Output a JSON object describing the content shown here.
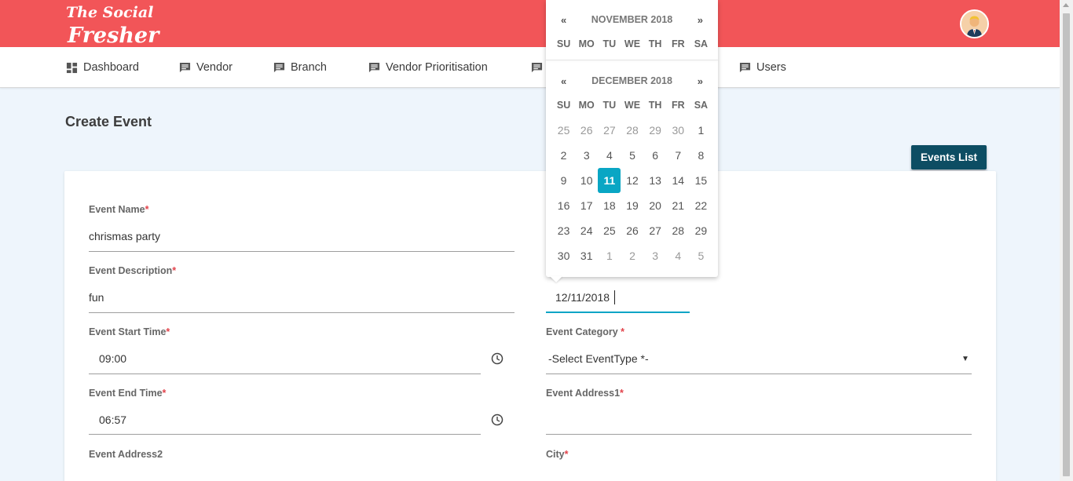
{
  "brand": {
    "logo_text": "The Social Fresher",
    "accent_color": "#f25558"
  },
  "nav": {
    "items": [
      {
        "label": "Dashboard",
        "icon": "dashboard-icon"
      },
      {
        "label": "Vendor",
        "icon": "chat-icon"
      },
      {
        "label": "Branch",
        "icon": "chat-icon"
      },
      {
        "label": "Vendor Prioritisation",
        "icon": "chat-icon"
      },
      {
        "label": "",
        "icon": "chat-icon"
      },
      {
        "label": "Users",
        "icon": "chat-icon"
      }
    ]
  },
  "page": {
    "title": "Create Event",
    "events_list_button": "Events List"
  },
  "form": {
    "required_mark": "*",
    "event_name": {
      "label": "Event Name",
      "value": "chrismas party"
    },
    "event_description": {
      "label": "Event Description",
      "value": "fun"
    },
    "event_date": {
      "value": "12/11/2018"
    },
    "event_start_time": {
      "label": "Event Start Time",
      "value": "09:00"
    },
    "event_category": {
      "label": "Event Category ",
      "value": "-Select EventType *-"
    },
    "event_end_time": {
      "label": "Event End Time",
      "value": "06:57"
    },
    "event_address1": {
      "label": "Event Address1",
      "value": ""
    },
    "event_address2": {
      "label": "Event Address2"
    },
    "city": {
      "label": "City"
    }
  },
  "datepicker": {
    "prev": "«",
    "next": "»",
    "month1": "NOVEMBER 2018",
    "month2": "DECEMBER 2018",
    "days_of_week": [
      "SU",
      "MO",
      "TU",
      "WE",
      "TH",
      "FR",
      "SA"
    ],
    "selected_day": "11",
    "weeks": [
      [
        "25",
        "26",
        "27",
        "28",
        "29",
        "30",
        "1"
      ],
      [
        "2",
        "3",
        "4",
        "5",
        "6",
        "7",
        "8"
      ],
      [
        "9",
        "10",
        "11",
        "12",
        "13",
        "14",
        "15"
      ],
      [
        "16",
        "17",
        "18",
        "19",
        "20",
        "21",
        "22"
      ],
      [
        "23",
        "24",
        "25",
        "26",
        "27",
        "28",
        "29"
      ],
      [
        "30",
        "31",
        "1",
        "2",
        "3",
        "4",
        "5"
      ]
    ],
    "selection_color": "#09a6c4"
  }
}
